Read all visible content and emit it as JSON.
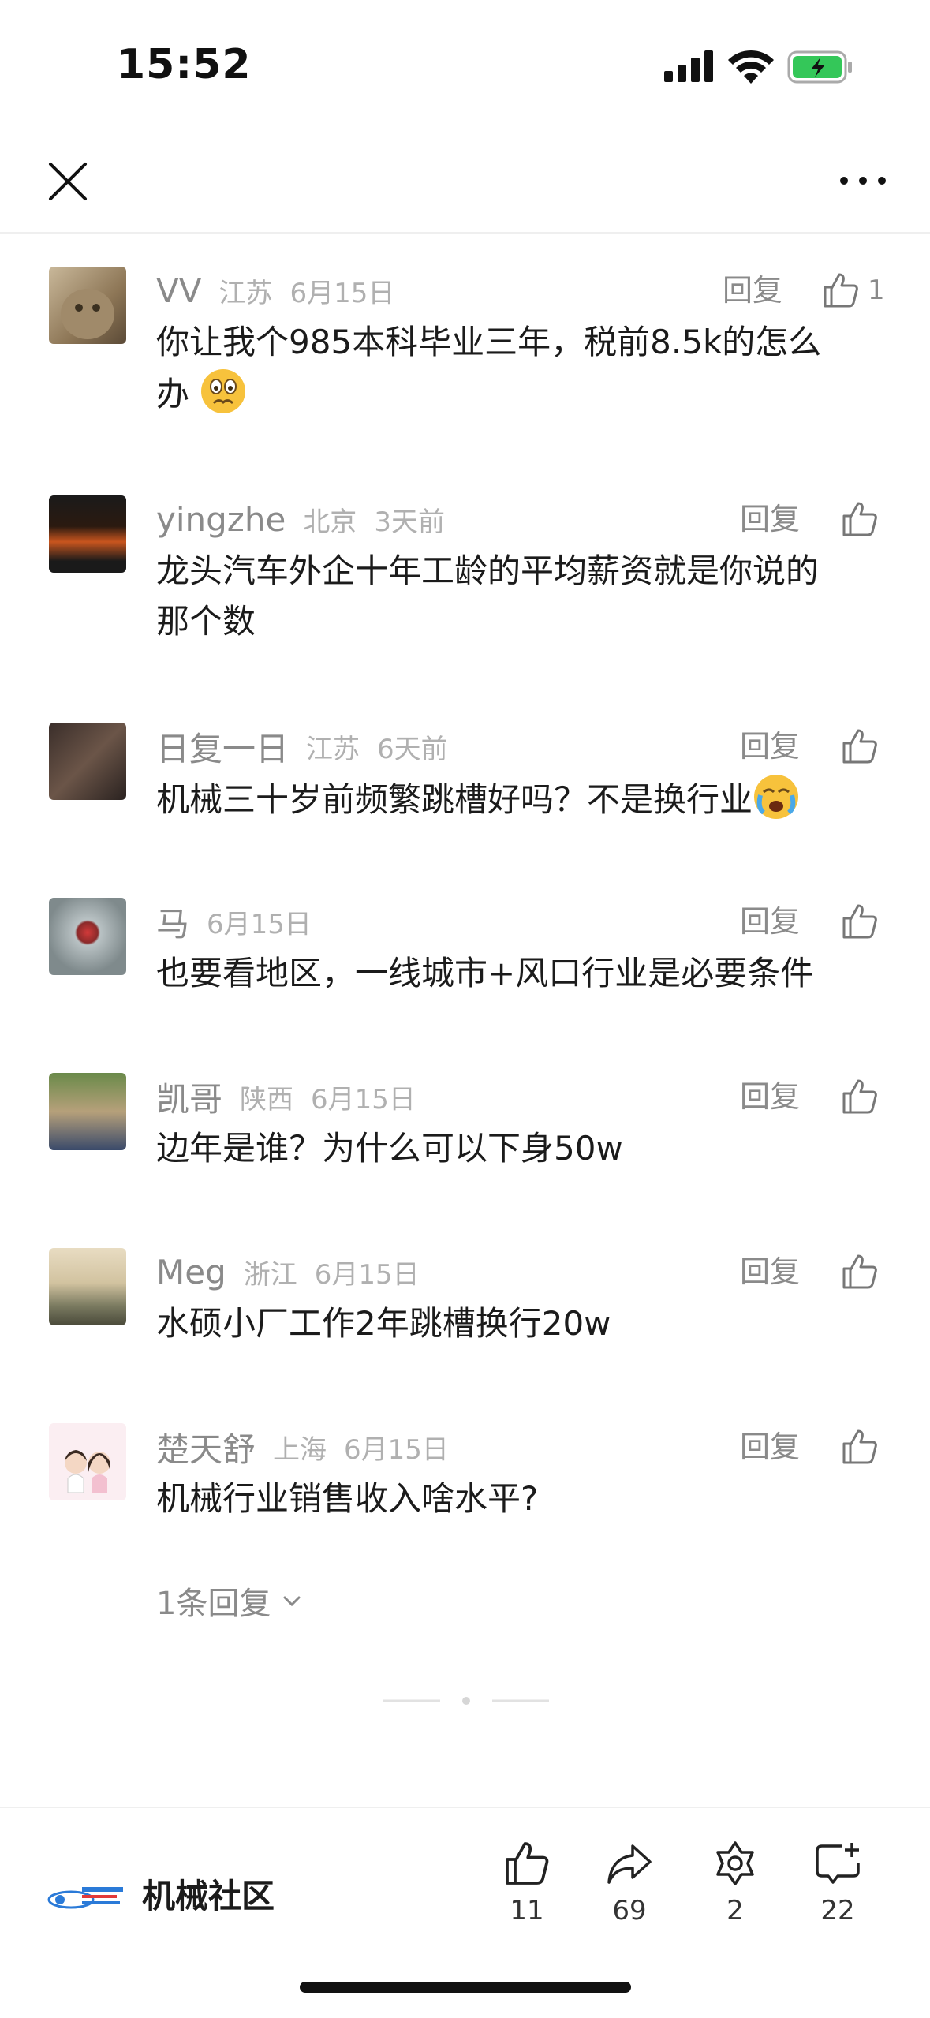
{
  "status_bar": {
    "time": "15:52"
  },
  "comments": [
    {
      "user": "VV",
      "location": "江苏",
      "time": "6月15日",
      "reply_label": "回复",
      "likes": "1",
      "text_lines": [
        "你让我个985本科毕业三年，税前8.5k的怎么",
        "办"
      ],
      "emoji": "worried-face"
    },
    {
      "user": "yingzhe",
      "location": "北京",
      "time": "3天前",
      "reply_label": "回复",
      "text_lines": [
        "龙头汽车外企十年工龄的平均薪资就是你说的",
        "那个数"
      ]
    },
    {
      "user": "日复一日",
      "location": "江苏",
      "time": "6天前",
      "reply_label": "回复",
      "text_lines": [
        "机械三十岁前频繁跳槽好吗？不是换行业"
      ],
      "emoji": "crying-face"
    },
    {
      "user": "马",
      "location": "",
      "time": "6月15日",
      "reply_label": "回复",
      "text_lines": [
        "也要看地区，一线城市+风口行业是必要条件"
      ]
    },
    {
      "user": "凯哥",
      "location": "陕西",
      "time": "6月15日",
      "reply_label": "回复",
      "text_lines": [
        "边年是谁？为什么可以下身50w"
      ]
    },
    {
      "user": "Meg",
      "location": "浙江",
      "time": "6月15日",
      "reply_label": "回复",
      "text_lines": [
        "水硕小厂工作2年跳槽换行20w"
      ]
    },
    {
      "user": "楚天舒",
      "location": "上海",
      "time": "6月15日",
      "reply_label": "回复",
      "text_lines": [
        "机械行业销售收入啥水平?"
      ]
    }
  ],
  "more_replies": "1条回复",
  "bottom_bar": {
    "community_name": "机械社区",
    "actions": [
      {
        "icon": "thumbs-up-icon",
        "count": "11"
      },
      {
        "icon": "share-icon",
        "count": "69"
      },
      {
        "icon": "star-badge-icon",
        "count": "2"
      },
      {
        "icon": "comment-add-icon",
        "count": "22"
      }
    ]
  },
  "colors": {
    "text": "#1b1b1b",
    "meta": "#8a8a8a",
    "meta_light": "#b0b0b0",
    "battery": "#34c759"
  }
}
